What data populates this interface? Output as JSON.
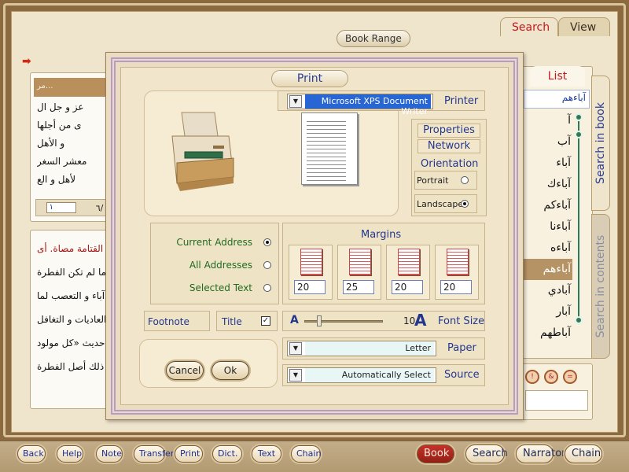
{
  "app": {
    "tabs": {
      "search": "Search",
      "view": "View"
    },
    "book_range": "Book Range"
  },
  "left_panel": {
    "header_text": "مر...",
    "upper_lines": [
      "عز و جل ال",
      "ى من أجلها",
      "و الأهل",
      "معشر السغر",
      "لأهل و الع"
    ],
    "nav_page": "١",
    "nav_total": "٦/",
    "lower_lines": [
      "القتامة مصاة. أى",
      "ما لم تكن الفطرة",
      "آباء و التعصب لما",
      "العاديات و التغافل",
      "حديث «كل مولود",
      "ذلك أصل الفطرة"
    ]
  },
  "list_panel": {
    "tab": "List",
    "search_value": "آباءهم",
    "items": [
      "آ",
      "آب",
      "آباء",
      "آباءك",
      "آباءكم",
      "آباءنا",
      "آباءه",
      "آباءهم",
      "آبادي",
      "آبار",
      "آباطهم"
    ],
    "selected_index": 7,
    "side_tabs": {
      "book": "Search in book",
      "contents": "Search in contents"
    },
    "mini_buttons": [
      "!",
      "&",
      "="
    ]
  },
  "toolbar": {
    "left": [
      "Back",
      "Help",
      "Note",
      "Transfer",
      "Print",
      "Dict.",
      "Text",
      "Chain"
    ],
    "right": [
      "Book",
      "Search",
      "Narrator",
      "Chain"
    ],
    "active": "Book"
  },
  "print_dialog": {
    "title": "Print",
    "printer_label": "Printer",
    "printer_value": "Microsoft XPS Document Writer",
    "properties": "Properties",
    "network": "Network",
    "orientation_label": "Orientation",
    "portrait": "Portrait",
    "landscape": "Landscape",
    "orientation_selected": "Landscape",
    "range_options": [
      "Current Address",
      "All Addresses",
      "Selected Text"
    ],
    "range_selected": "Current Address",
    "margins_label": "Margins",
    "margins": [
      "20",
      "25",
      "20",
      "20"
    ],
    "footnote": "Footnote",
    "title_option": "Title",
    "title_checked": true,
    "font_size_label": "Font Size",
    "font_size_value": "10",
    "font_small_glyph": "A",
    "font_large_glyph": "A",
    "paper_label": "Paper",
    "paper_value": "Letter",
    "source_label": "Source",
    "source_value": "Automatically Select",
    "cancel": "Cancel",
    "ok": "Ok"
  }
}
